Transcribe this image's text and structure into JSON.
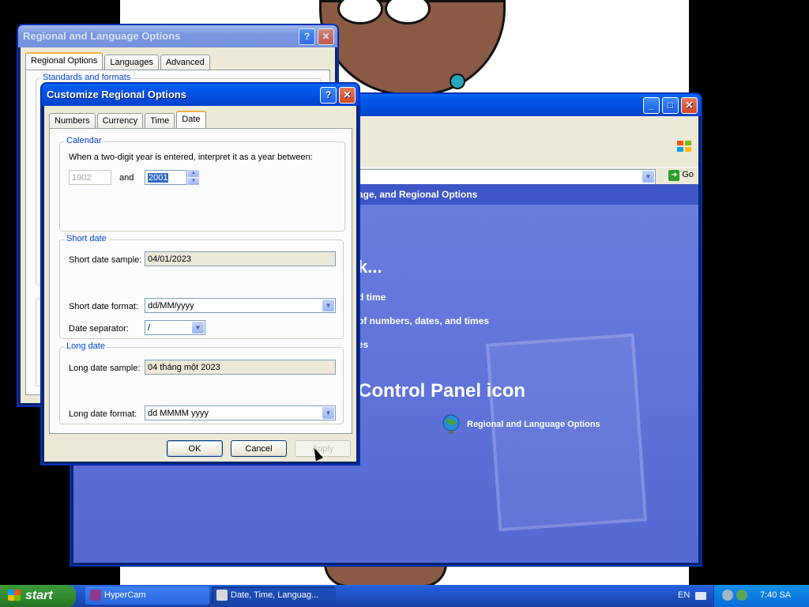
{
  "control_panel": {
    "crumb": "age, and Regional Options",
    "pick_heading": "k...",
    "task1": "d time",
    "task2": "of numbers, dates, and times",
    "task3": "es",
    "cp_icon_heading": "Control Panel icon",
    "cp_icon_item": "Regional and Language Options",
    "go_label": "Go"
  },
  "regional_window": {
    "title": "Regional and Language Options",
    "tabs": [
      "Regional Options",
      "Languages",
      "Advanced"
    ],
    "group_label": "Standards and formats"
  },
  "customize_dialog": {
    "title": "Customize Regional Options",
    "tabs": [
      "Numbers",
      "Currency",
      "Time",
      "Date"
    ],
    "calendar": {
      "label": "Calendar",
      "text": "When a two-digit year is entered, interpret it as a year between:",
      "from_year": "1902",
      "and_label": "and",
      "to_year": "2001"
    },
    "short_date": {
      "label": "Short date",
      "sample_label": "Short date sample:",
      "sample_value": "04/01/2023",
      "format_label": "Short date format:",
      "format_value": "dd/MM/yyyy",
      "separator_label": "Date separator:",
      "separator_value": "/"
    },
    "long_date": {
      "label": "Long date",
      "sample_label": "Long date sample:",
      "sample_value": "04 tháng một 2023",
      "format_label": "Long date format:",
      "format_value": "dd MMMM yyyy"
    },
    "buttons": {
      "ok": "OK",
      "cancel": "Cancel",
      "apply": "Apply"
    }
  },
  "taskbar": {
    "start": "start",
    "tasks": [
      "HyperCam",
      "Date, Time, Languag..."
    ],
    "lang": "EN",
    "clock": "7:40 SA"
  }
}
